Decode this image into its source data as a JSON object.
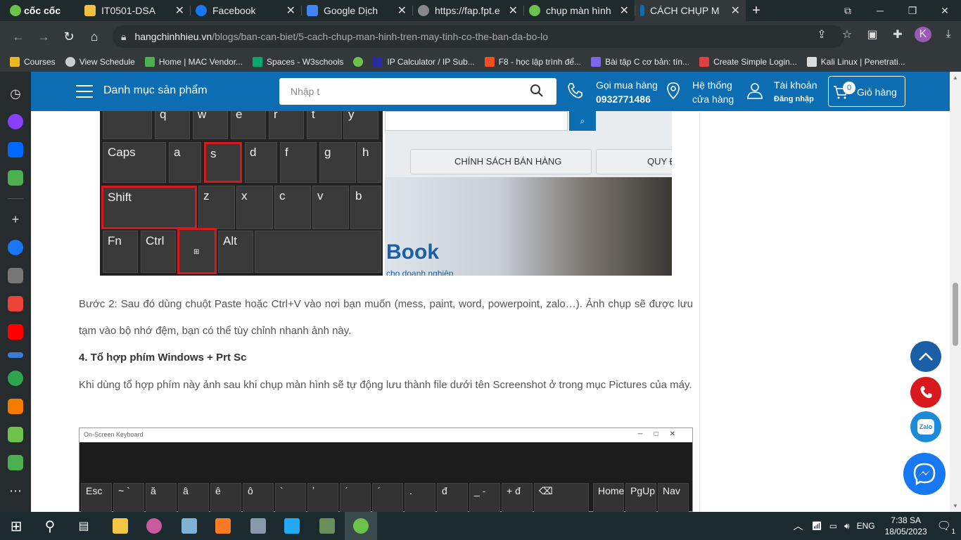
{
  "browser": {
    "brand": "cốc cốc",
    "tabs": [
      {
        "title": "IT0501-DSA",
        "color": "#f0c040"
      },
      {
        "title": "Facebook",
        "color": "#1877f2"
      },
      {
        "title": "Google Dịch",
        "color": "#4285f4"
      },
      {
        "title": "https://fap.fpt.e",
        "color": "#888888"
      },
      {
        "title": "chụp màn hình",
        "color": "#6cc24a"
      },
      {
        "title": "CÁCH CHỤP M",
        "color": "#0d6db3"
      }
    ],
    "url_host": "hangchinhhieu.vn",
    "url_path": "/blogs/ban-can-biet/5-cach-chup-man-hinh-tren-may-tinh-co-the-ban-da-bo-lo",
    "profile_initial": "K",
    "bookmarks": [
      {
        "label": "Courses",
        "color": "#e8b820"
      },
      {
        "label": "View Schedule",
        "color": "#cccccc"
      },
      {
        "label": "Home | MAC Vendor...",
        "color": "#4caf50"
      },
      {
        "label": "Spaces - W3schools",
        "color": "#04aa6d"
      },
      {
        "label": "",
        "color": "#6cc24a"
      },
      {
        "label": "IP Calculator / IP Sub...",
        "color": "#2b2b9b"
      },
      {
        "label": "F8 - học lập trình để...",
        "color": "#f05123"
      },
      {
        "label": "Bài tập C cơ bản: tín...",
        "color": "#7b68ee"
      },
      {
        "label": "Create Simple Login...",
        "color": "#e04040"
      },
      {
        "label": "Kali Linux | Penetrati...",
        "color": "#dddddd"
      }
    ]
  },
  "site": {
    "menu_label": "Danh mục sản phẩm",
    "search_placeholder": "Nhập t",
    "hotline_label": "Gọi mua hàng",
    "hotline_number": "0932771486",
    "stores_line1": "Hệ thống",
    "stores_line2": "cửa hàng",
    "account_label": "Tài khoản",
    "account_sub": "Đăng nhập",
    "cart_count": "0",
    "cart_label": "Giỏ hàng",
    "brand_color": "#0d6db3"
  },
  "keyboard_image": {
    "top_row": [
      "q",
      "w",
      "e",
      "r",
      "t",
      "y"
    ],
    "keys": [
      "Caps",
      "a",
      "s",
      "d",
      "f",
      "g",
      "h",
      "Shift",
      "z",
      "x",
      "c",
      "v",
      "b",
      "Fn",
      "Ctrl",
      "Alt"
    ],
    "site_banner_tab": "CHÍNH SÁCH BÁN HÀNG",
    "site_banner_tab2": "QUY Đ",
    "site_banner_big": "Book",
    "site_banner_small": "cho doanh nghiệp"
  },
  "article": {
    "step2": "Bước 2: Sau đó dùng chuột Paste hoặc Ctrl+V vào nơi bạn muốn (mess, paint, word, powerpoint, zalo…). Ảnh chụp sẽ được lưu tạm vào bộ nhớ đệm, bạn có thể tùy chỉnh nhanh ảnh này.",
    "heading4": "4. Tổ hợp phím Windows + Prt Sc",
    "para4": "Khi dùng tổ hợp phím này ảnh sau khi chụp màn hình sẽ tự động lưu thành file dưới tên Screenshot ở trong mục Pictures của máy.",
    "osk_title": "On-Screen Keyboard",
    "osk_keys": [
      "Esc",
      "~ `",
      "ă",
      "â",
      "ê",
      "ô",
      "`",
      "ʼ",
      "ˊ",
      "ˊ",
      ".",
      "đ",
      "_ -",
      "+ đ",
      "⌫",
      "Home",
      "PgUp",
      "Nav"
    ]
  },
  "taskbar": {
    "time": "7:38 SA",
    "date": "18/05/2023",
    "lang": "ENG",
    "notifications": "1"
  }
}
